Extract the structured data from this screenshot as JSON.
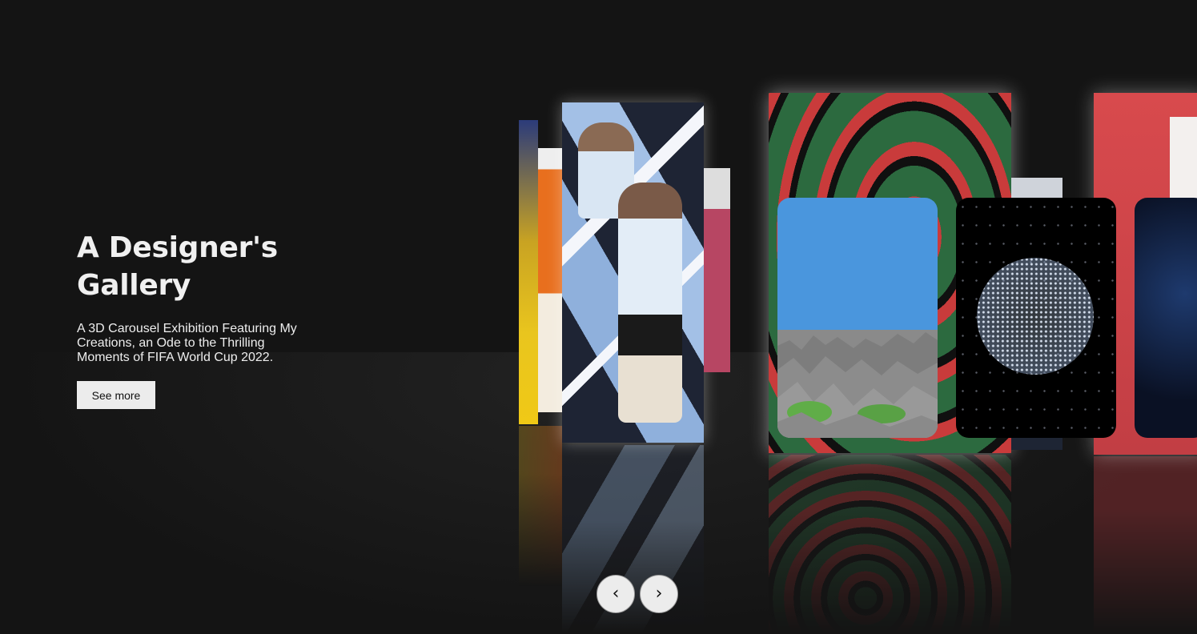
{
  "hero": {
    "title": "A Designer's Gallery",
    "description": "A 3D Carousel Exhibition Featuring My Creations, an Ode to the Thrilling Moments of FIFA World Cup 2022.",
    "button_label": "See more"
  },
  "carousel": {
    "posters": [
      {
        "name": "yellow-blue-poster-edge"
      },
      {
        "name": "orange-player-poster"
      },
      {
        "name": "messi-argentina-poster"
      },
      {
        "name": "pink-text-poster"
      },
      {
        "name": "green-red-swirl-poster"
      },
      {
        "name": "navy-poster-edge"
      },
      {
        "name": "red-poster"
      }
    ],
    "cards": [
      {
        "name": "terrain-3d-card"
      },
      {
        "name": "particle-sphere-card"
      },
      {
        "name": "space-card"
      }
    ]
  },
  "nav": {
    "prev_icon": "chevron-left-icon",
    "prev_glyph": "‹",
    "next_icon": "chevron-right-icon",
    "next_glyph": "›"
  }
}
